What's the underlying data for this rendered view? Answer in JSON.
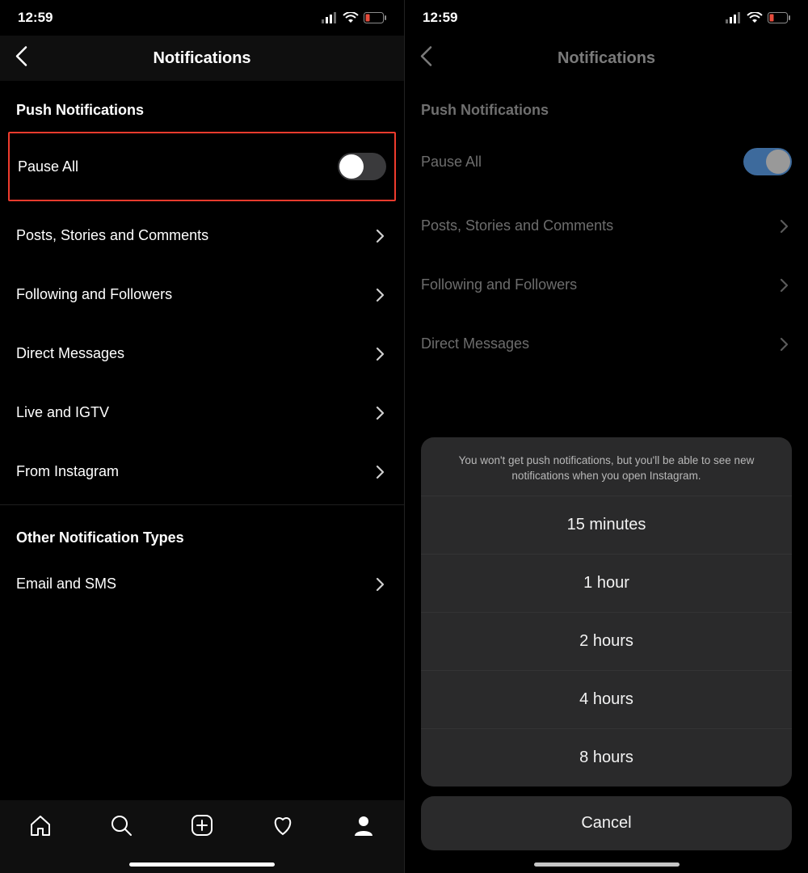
{
  "status": {
    "time": "12:59"
  },
  "header": {
    "title": "Notifications"
  },
  "sections": {
    "push": {
      "header": "Push Notifications",
      "pause_all": "Pause All",
      "items": [
        {
          "label": "Posts, Stories and Comments"
        },
        {
          "label": "Following and Followers"
        },
        {
          "label": "Direct Messages"
        },
        {
          "label": "Live and IGTV"
        },
        {
          "label": "From Instagram"
        }
      ]
    },
    "other": {
      "header": "Other Notification Types",
      "items": [
        {
          "label": "Email and SMS"
        }
      ]
    }
  },
  "sheet": {
    "message": "You won't get push notifications, but you'll be able to see new notifications when you open Instagram.",
    "options": [
      "15 minutes",
      "1 hour",
      "2 hours",
      "4 hours",
      "8 hours"
    ],
    "cancel": "Cancel"
  },
  "left": {
    "pause_all_on": false
  },
  "right": {
    "pause_all_on": true
  }
}
